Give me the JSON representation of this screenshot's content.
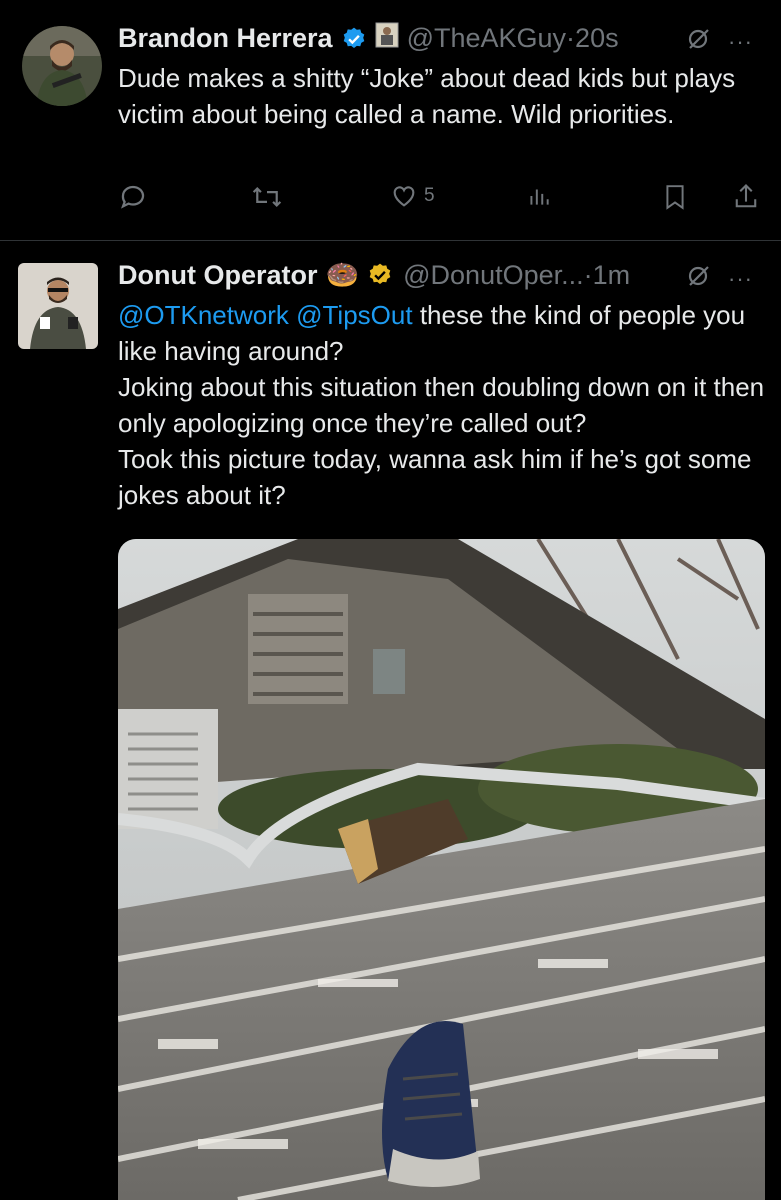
{
  "tweets": [
    {
      "name": "Brandon Herrera",
      "handle": "@TheAKGuy",
      "dot": "·",
      "time": "20s",
      "text": "Dude makes a shitty “Joke” about dead kids but plays victim about being called a name. Wild priorities.",
      "likes": "5",
      "badge_color": "#1d9bf0"
    },
    {
      "name": "Donut Operator",
      "handle": "@DonutOper...",
      "dot": "·",
      "time": "1m",
      "mention1": "@OTKnetwork",
      "mention2": "@TipsOut",
      "text_rest": " these the kind of people you like having around?",
      "line2": "Joking about this situation then doubling down on it then only apologizing once they’re called out?",
      "line3": "Took this picture today, wanna ask him if he’s got some jokes about it?",
      "badge_color": "#e8b923",
      "emoji": "🍩"
    }
  ],
  "icons": {
    "more": "···"
  }
}
